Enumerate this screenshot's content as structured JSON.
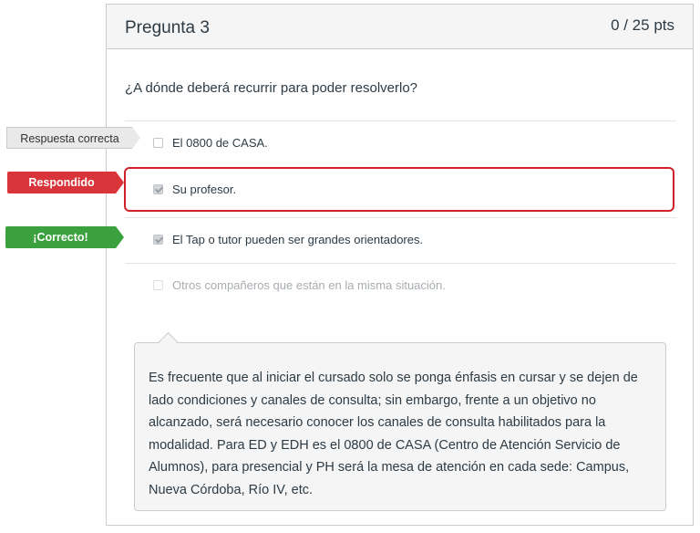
{
  "question": {
    "title": "Pregunta 3",
    "points": "0 / 25 pts",
    "text": "¿A dónde deberá recurrir para poder resolverlo?"
  },
  "answers": [
    {
      "label": "El 0800 de CASA.",
      "checked": false
    },
    {
      "label": "Su profesor.",
      "checked": true
    },
    {
      "label": "El Tap o tutor pueden ser grandes orientadores.",
      "checked": true
    },
    {
      "label": "Otros compañeros que están en la misma situación.",
      "checked": false
    }
  ],
  "flags": {
    "correct_answer": "Respuesta correcta",
    "answered": "Respondido",
    "correct": "¡Correcto!"
  },
  "comment": "Es frecuente que al iniciar el cursado solo se ponga énfasis en cursar y se dejen de lado condiciones y canales de consulta; sin embargo, frente a un objetivo no alcanzado, será necesario conocer los canales de consulta habilitados para la modalidad. Para ED y EDH es el 0800 de CASA (Centro de Atención Servicio de Alumnos), para presencial y PH será la mesa de atención en cada sede: Campus, Nueva Córdoba, Río IV, etc.",
  "colors": {
    "answered_flag": "#d9343a",
    "correct_flag": "#3aa13e",
    "selected_border": "#d0202a"
  }
}
